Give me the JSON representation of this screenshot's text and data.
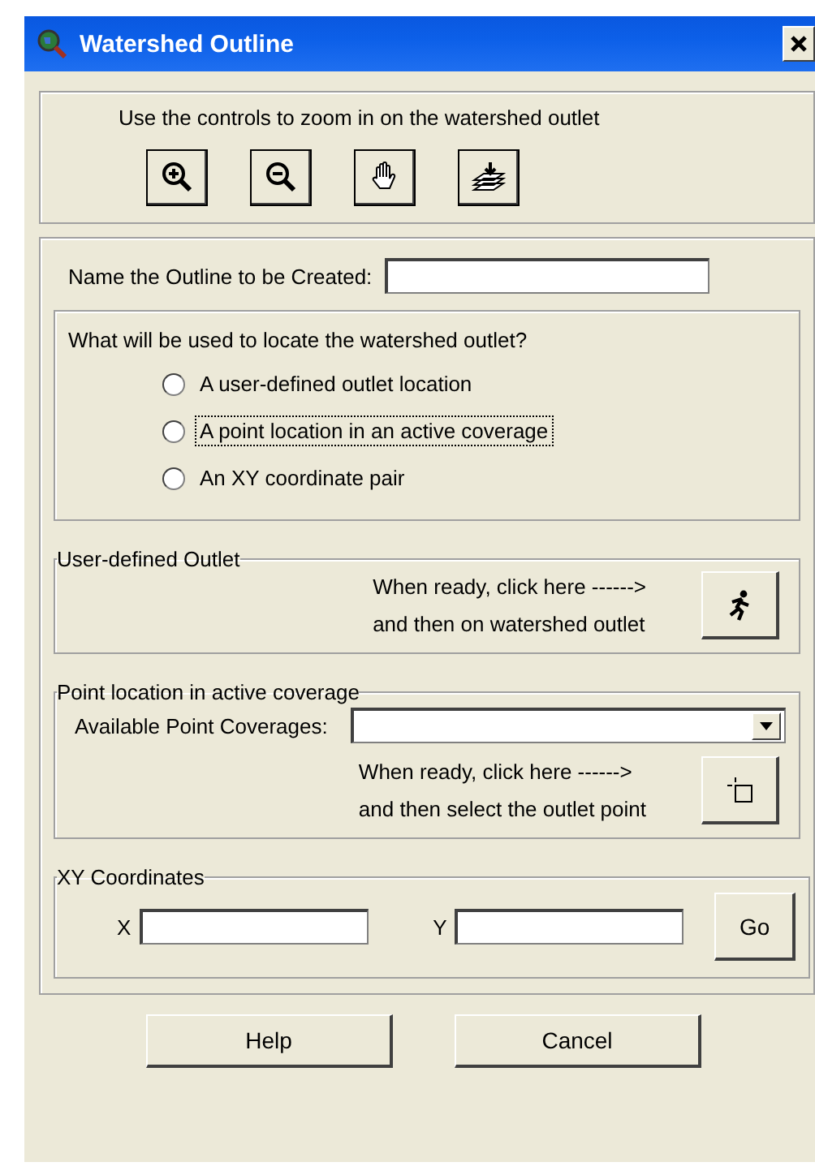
{
  "window": {
    "title": "Watershed Outline"
  },
  "zoom_panel": {
    "instruction": "Use the controls to zoom in on the watershed outlet",
    "tools": [
      {
        "kind": "zoom-in"
      },
      {
        "kind": "zoom-out"
      },
      {
        "kind": "pan"
      },
      {
        "kind": "full-extent"
      }
    ]
  },
  "name_field": {
    "label": "Name the Outline to be Created:"
  },
  "locate_group": {
    "question": "What will be used to locate the watershed outlet?",
    "options": [
      {
        "label": "A user-defined outlet location",
        "selected": false,
        "focused": false
      },
      {
        "label": "A point location in an active coverage",
        "selected": false,
        "focused": true
      },
      {
        "label": "An XY coordinate pair",
        "selected": false,
        "focused": false
      }
    ]
  },
  "user_outlet": {
    "legend": "User-defined Outlet",
    "lines": [
      "When ready, click here  ------>",
      "and then on watershed outlet"
    ]
  },
  "point_location": {
    "legend": "Point location in active coverage",
    "dropdown_label": "Available Point Coverages:",
    "lines": [
      "When ready, click here  ------>",
      "and then select the outlet point"
    ]
  },
  "xy": {
    "legend": "XY Coordinates",
    "x_label": "X",
    "y_label": "Y",
    "button": "Go"
  },
  "buttons": [
    "Help",
    "Cancel"
  ]
}
